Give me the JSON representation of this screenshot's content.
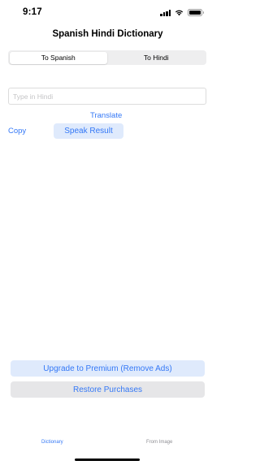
{
  "status_bar": {
    "time": "9:17",
    "icons": [
      "cellular-signal-icon",
      "wifi-icon",
      "battery-icon"
    ]
  },
  "nav": {
    "title": "Spanish Hindi Dictionary"
  },
  "mode_selector": {
    "options": [
      "To Spanish",
      "To Hindi"
    ],
    "selected": "To Spanish"
  },
  "input": {
    "placeholder": "Type in Hindi",
    "value": ""
  },
  "actions": {
    "translate_label": "Translate",
    "copy_label": "Copy",
    "speak_label": "Speak Result"
  },
  "purchase": {
    "upgrade_label": "Upgrade to Premium (Remove Ads)",
    "restore_label": "Restore Purchases"
  },
  "tabs": {
    "items": [
      "Dictionary",
      "From Image"
    ],
    "active": "Dictionary"
  },
  "colors": {
    "accent": "#3478f6",
    "accent_tint": "#dfeafc",
    "inactive_tab": "#8e8e93"
  }
}
